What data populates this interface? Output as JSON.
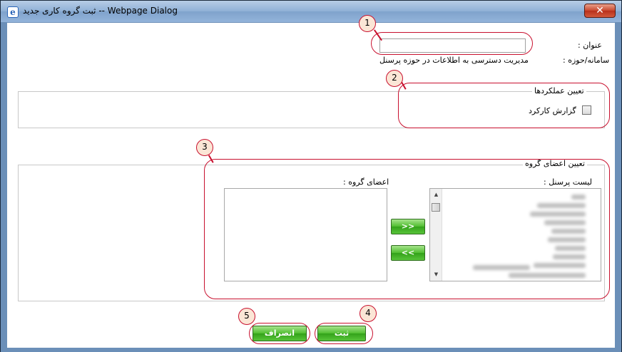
{
  "window": {
    "title": "ثبت گروه کاری جدید -- Webpage Dialog",
    "close_label": "✕"
  },
  "form": {
    "title_label": "عنوان :",
    "title_value": "",
    "system_label": "سامانه/حوزه :",
    "system_value": "مدیریت دسترسی به اطلاعات در حوزه پرسنل"
  },
  "functions": {
    "legend": "تعیین عملکردها",
    "items": [
      {
        "label": "گزارش کارکرد",
        "checked": false
      }
    ]
  },
  "members": {
    "legend": "تعیین اعضای گروه",
    "personnel_label": "لیست پرسنل :",
    "group_label": "اعضای گروه :",
    "add_label": "<<",
    "remove_label": ">>"
  },
  "actions": {
    "submit_label": "ثبت",
    "cancel_label": "انصراف"
  },
  "annotations": [
    "1",
    "2",
    "3",
    "4",
    "5"
  ],
  "colors": {
    "annotation": "#c8102e",
    "button_green": "#4fbd2f",
    "window_frame": "#6b8fb8"
  }
}
